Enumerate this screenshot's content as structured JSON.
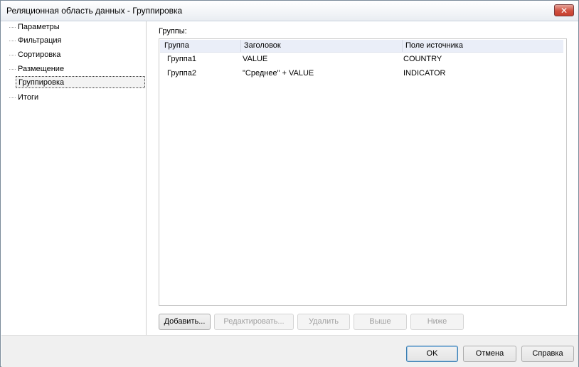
{
  "window": {
    "title": "Реляционная область данных - Группировка",
    "close_glyph": "✕"
  },
  "nav": {
    "items": [
      {
        "label": "Параметры",
        "selected": false
      },
      {
        "label": "Фильтрация",
        "selected": false
      },
      {
        "label": "Сортировка",
        "selected": false
      },
      {
        "label": "Размещение",
        "selected": false
      },
      {
        "label": "Группировка",
        "selected": true
      },
      {
        "label": "Итоги",
        "selected": false
      }
    ]
  },
  "groups": {
    "label": "Группы:",
    "columns": [
      "Группа",
      "Заголовок",
      "Поле источника"
    ],
    "rows": [
      [
        "Группа1",
        "VALUE",
        "COUNTRY"
      ],
      [
        "Группа2",
        "\"Среднее\" + VALUE",
        "INDICATOR"
      ]
    ]
  },
  "actions": {
    "add": "Добавить...",
    "edit": "Редактировать...",
    "delete": "Удалить",
    "up": "Выше",
    "down": "Ниже"
  },
  "dialog_buttons": {
    "ok": "OK",
    "cancel": "Отмена",
    "help": "Справка"
  }
}
